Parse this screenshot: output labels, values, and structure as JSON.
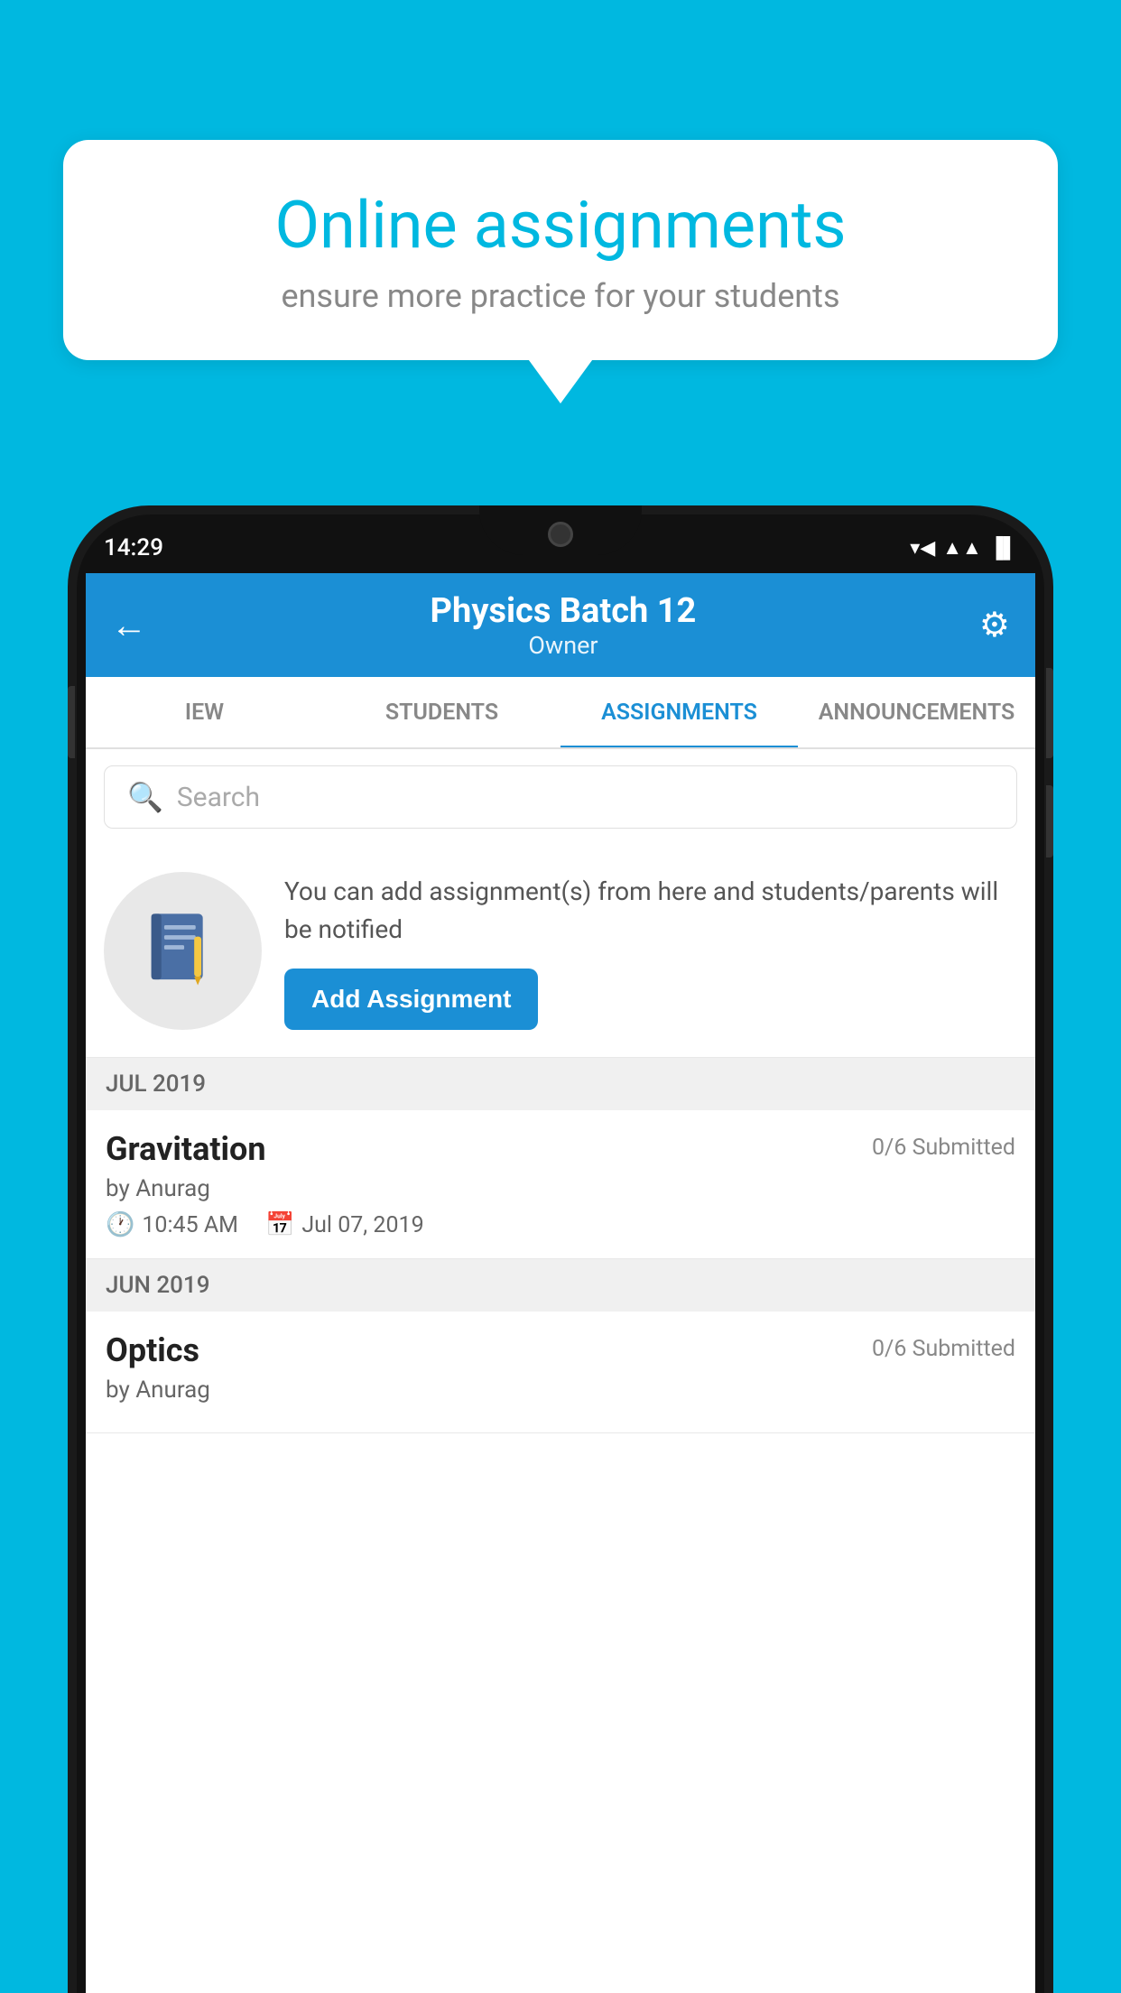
{
  "background_color": "#00B8E0",
  "speech_bubble": {
    "title": "Online assignments",
    "subtitle": "ensure more practice for your students"
  },
  "status_bar": {
    "time": "14:29",
    "wifi_icon": "▼▲",
    "signal_icon": "▲▲",
    "battery_icon": "▐"
  },
  "app_header": {
    "title": "Physics Batch 12",
    "subtitle": "Owner",
    "back_icon": "←",
    "settings_icon": "⚙"
  },
  "tabs": [
    {
      "label": "IEW",
      "active": false
    },
    {
      "label": "STUDENTS",
      "active": false
    },
    {
      "label": "ASSIGNMENTS",
      "active": true
    },
    {
      "label": "ANNOUNCEMENTS",
      "active": false
    }
  ],
  "search": {
    "placeholder": "Search"
  },
  "add_assignment_section": {
    "description": "You can add assignment(s) from here and students/parents will be notified",
    "button_label": "Add Assignment"
  },
  "sections": [
    {
      "header": "JUL 2019",
      "assignments": [
        {
          "name": "Gravitation",
          "submitted": "0/6 Submitted",
          "by": "by Anurag",
          "time": "10:45 AM",
          "date": "Jul 07, 2019"
        }
      ]
    },
    {
      "header": "JUN 2019",
      "assignments": [
        {
          "name": "Optics",
          "submitted": "0/6 Submitted",
          "by": "by Anurag",
          "time": "",
          "date": ""
        }
      ]
    }
  ]
}
